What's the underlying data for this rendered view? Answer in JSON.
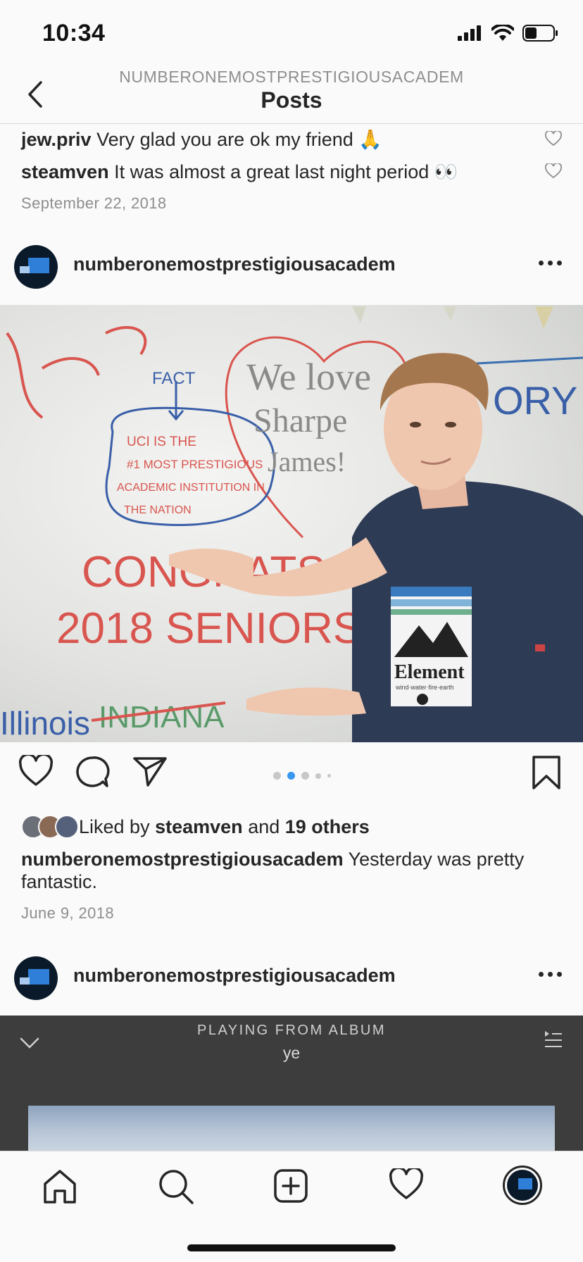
{
  "status_bar": {
    "time": "10:34"
  },
  "nav": {
    "username": "NUMBERONEMOSTPRESTIGIOUSACADEM",
    "title": "Posts"
  },
  "prev_post": {
    "comments": [
      {
        "user": "jew.priv",
        "text": "Very glad you are ok my friend 🙏"
      },
      {
        "user": "steamven",
        "text": "It was almost a great last night period 👀"
      }
    ],
    "date": "September 22, 2018"
  },
  "post": {
    "username": "numberonemostprestigiousacadem",
    "photo": {
      "whiteboard_text": {
        "fact": "FACT",
        "line1": "UCI IS THE",
        "line2": "#1 MOST PRESTIGIOUS",
        "line3": "ACADEMIC INSTITUTION IN",
        "line4": "THE NATION",
        "heart1": "We love",
        "heart2": "Sharpe",
        "heart3": "James!",
        "congrats": "CONGRATS",
        "year": "2018 SENIORS",
        "illinois": "Illinois",
        "indiana": "INDIANA",
        "story": "ORY",
        "shirt_brand": "Element",
        "shirt_tagline": "wind·water·fire·earth"
      }
    },
    "carousel": {
      "count": 5,
      "active": 1
    },
    "likes": {
      "prefix": "Liked by",
      "user": "steamven",
      "joiner": "and",
      "others": "19 others"
    },
    "caption": {
      "user": "numberonemostprestigiousacadem",
      "text": "Yesterday was pretty fantastic."
    },
    "date": "June 9, 2018"
  },
  "next_post": {
    "username": "numberonemostprestigiousacadem",
    "media": {
      "label": "PLAYING FROM ALBUM",
      "album": "ye"
    }
  },
  "tabbar": {
    "items": [
      "home-icon",
      "search-icon",
      "new-post-icon",
      "activity-heart-icon",
      "profile-avatar"
    ]
  },
  "colors": {
    "accent": "#3897f0",
    "text": "#262626",
    "secondary": "#8e8e8e",
    "border": "#dbdbdb"
  }
}
